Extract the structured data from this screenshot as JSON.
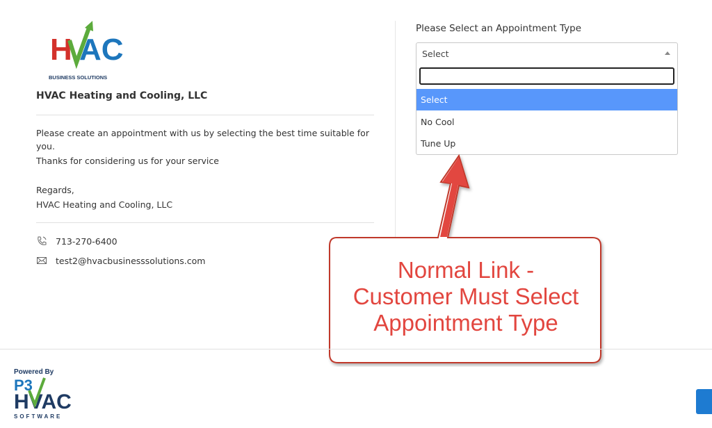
{
  "brand": {
    "logo_name": "HVAC",
    "logo_tagline": "BUSINESS SOLUTIONS",
    "company_name": "HVAC Heating and Cooling, LLC"
  },
  "message": {
    "line1": "Please create an appointment with us by selecting the best time suitable for",
    "line2": "you.",
    "line3": "Thanks for considering us for your service",
    "regards": "Regards,",
    "signature": "HVAC Heating and Cooling, LLC"
  },
  "contact": {
    "phone": "713-270-6400",
    "email": "test2@hvacbusinesssolutions.com",
    "phone_icon": "phone-icon",
    "email_icon": "mail-icon"
  },
  "appointment": {
    "label": "Please Select an Appointment Type",
    "selected": "Select",
    "search_value": "",
    "options": [
      "Select",
      "No Cool",
      "Tune Up"
    ],
    "highlighted_index": 0,
    "highlight_color": "#5897fb"
  },
  "callout": {
    "line1": "Normal Link -",
    "line2": "Customer Must Select",
    "line3": "Appointment Type",
    "color": "#e2463f"
  },
  "footer": {
    "powered_by": "Powered By",
    "p3": "P3",
    "hvac": "HVAC",
    "software": "SOFTWARE",
    "button_color": "#1e7bd1"
  }
}
